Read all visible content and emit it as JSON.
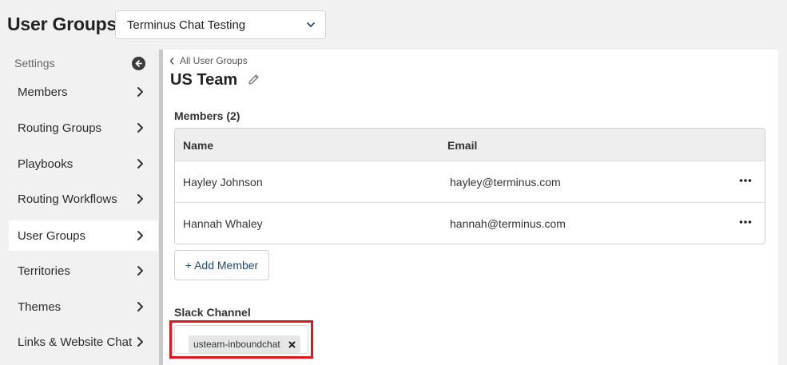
{
  "page": {
    "title": "User Groups"
  },
  "workspace_select": {
    "value": "Terminus Chat Testing"
  },
  "sidebar": {
    "header": "Settings",
    "items": [
      {
        "label": "Members"
      },
      {
        "label": "Routing Groups"
      },
      {
        "label": "Playbooks"
      },
      {
        "label": "Routing Workflows"
      },
      {
        "label": "User Groups"
      },
      {
        "label": "Territories"
      },
      {
        "label": "Themes"
      },
      {
        "label": "Links & Website Chat"
      }
    ],
    "active": "User Groups"
  },
  "main": {
    "back_link": "All User Groups",
    "group_name": "US Team",
    "members_label": "Members (2)",
    "table": {
      "columns": [
        "Name",
        "Email"
      ],
      "rows": [
        {
          "name": "Hayley Johnson",
          "email": "hayley@terminus.com"
        },
        {
          "name": "Hannah Whaley",
          "email": "hannah@terminus.com"
        }
      ]
    },
    "add_member_label": "+ Add Member",
    "slack_channel_label": "Slack Channel",
    "slack_channel_chip": "usteam-inboundchat"
  },
  "colors": {
    "highlight_border": "#e0161c",
    "link_blue": "#1f4a6e",
    "background": "#f1f1f1"
  },
  "icons": {
    "workspace_select": "chevron-down-icon",
    "collapse": "arrow-left-circle-icon",
    "sidebar_items": "chevron-right-icon",
    "back": "chevron-left-icon",
    "edit": "pencil-icon",
    "row_menu": "more-horizontal-icon",
    "chip_remove": "close-icon"
  }
}
